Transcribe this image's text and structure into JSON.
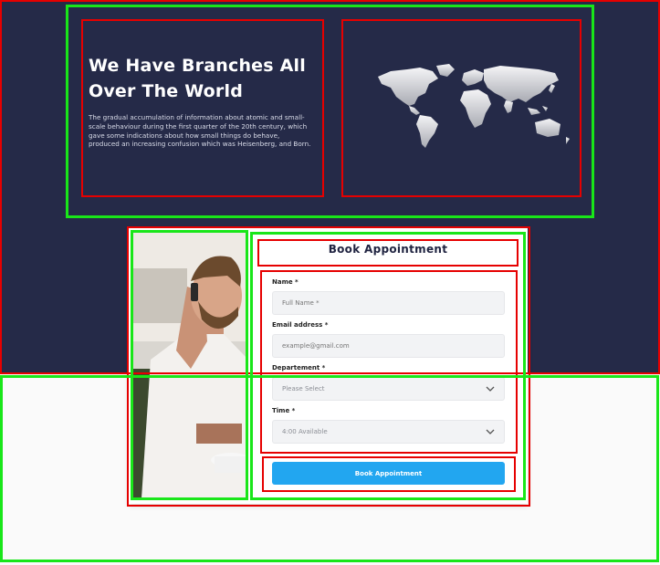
{
  "hero": {
    "title": "We Have Branches All Over The World",
    "description": "The gradual accumulation of information about atomic and small-scale behaviour during the first quarter of the 20th century, which gave some indications about how small things do behave, produced an increasing confusion which was Heisenberg, and Born."
  },
  "form": {
    "title": "Book Appointment",
    "name_label": "Name *",
    "name_placeholder": "Full Name *",
    "email_label": "Email address *",
    "email_placeholder": "example@gmail.com",
    "department_label": "Departement *",
    "department_value": "Please Select",
    "time_label": "Time *",
    "time_value": "4:00 Available",
    "submit_label": "Book Appointment"
  },
  "colors": {
    "hero_bg": "#252a48",
    "button": "#22a6f0"
  }
}
